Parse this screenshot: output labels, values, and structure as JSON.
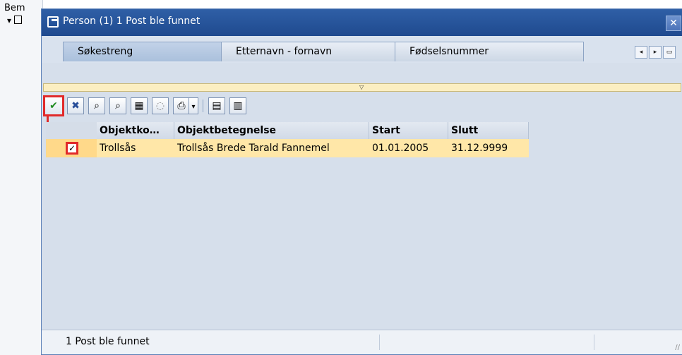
{
  "background": {
    "header_text": "Bem",
    "tree_toggle": "▾"
  },
  "dialog": {
    "title": "Person (1)   1 Post ble funnet",
    "close_symbol": "✕",
    "tabs": [
      {
        "label": "Søkestreng",
        "active": true
      },
      {
        "label": "Etternavn - fornavn",
        "active": false
      },
      {
        "label": "Fødselsnummer",
        "active": false
      }
    ],
    "tab_nav": [
      "◂",
      "▸",
      "▭"
    ],
    "collapse_symbol": "▽",
    "toolbar": {
      "buttons": [
        {
          "name": "confirm-check-icon",
          "glyph": "✔",
          "color": "#1f8a1f"
        },
        {
          "name": "cancel-x-icon",
          "glyph": "✖",
          "color": "#2a4f9a"
        },
        {
          "name": "find-binoculars-icon",
          "glyph": "⌕",
          "color": "#333333"
        },
        {
          "name": "find-next-binoculars-icon",
          "glyph": "⌕",
          "color": "#333333"
        },
        {
          "name": "filter-icon",
          "glyph": "▦",
          "color": "#444444"
        },
        {
          "name": "help-info-icon",
          "glyph": "◌",
          "color": "#666666"
        },
        {
          "name": "print-icon",
          "glyph": "⎙",
          "color": "#333333"
        },
        {
          "name": "print-dropdown-icon",
          "glyph": "▾",
          "color": "#333333"
        },
        {
          "name": "export-icon",
          "glyph": "▤",
          "color": "#333333"
        },
        {
          "name": "layout-icon",
          "glyph": "▥",
          "color": "#333333"
        }
      ]
    },
    "grid": {
      "columns": [
        "Objektko…",
        "Objektbetegnelse",
        "Start",
        "Slutt"
      ],
      "rows": [
        {
          "checked": "✓",
          "cells": [
            "Trollsås",
            "Trollsås Brede Tarald Fannemel",
            "01.01.2005",
            "31.12.9999"
          ]
        }
      ]
    },
    "status": {
      "text": "1 Post ble funnet",
      "resize_grip": "//"
    },
    "colors": {
      "title_bar": "#1f4a8f",
      "highlight_row": "#ffe7a8",
      "annotation_red": "#e12a2a"
    }
  }
}
